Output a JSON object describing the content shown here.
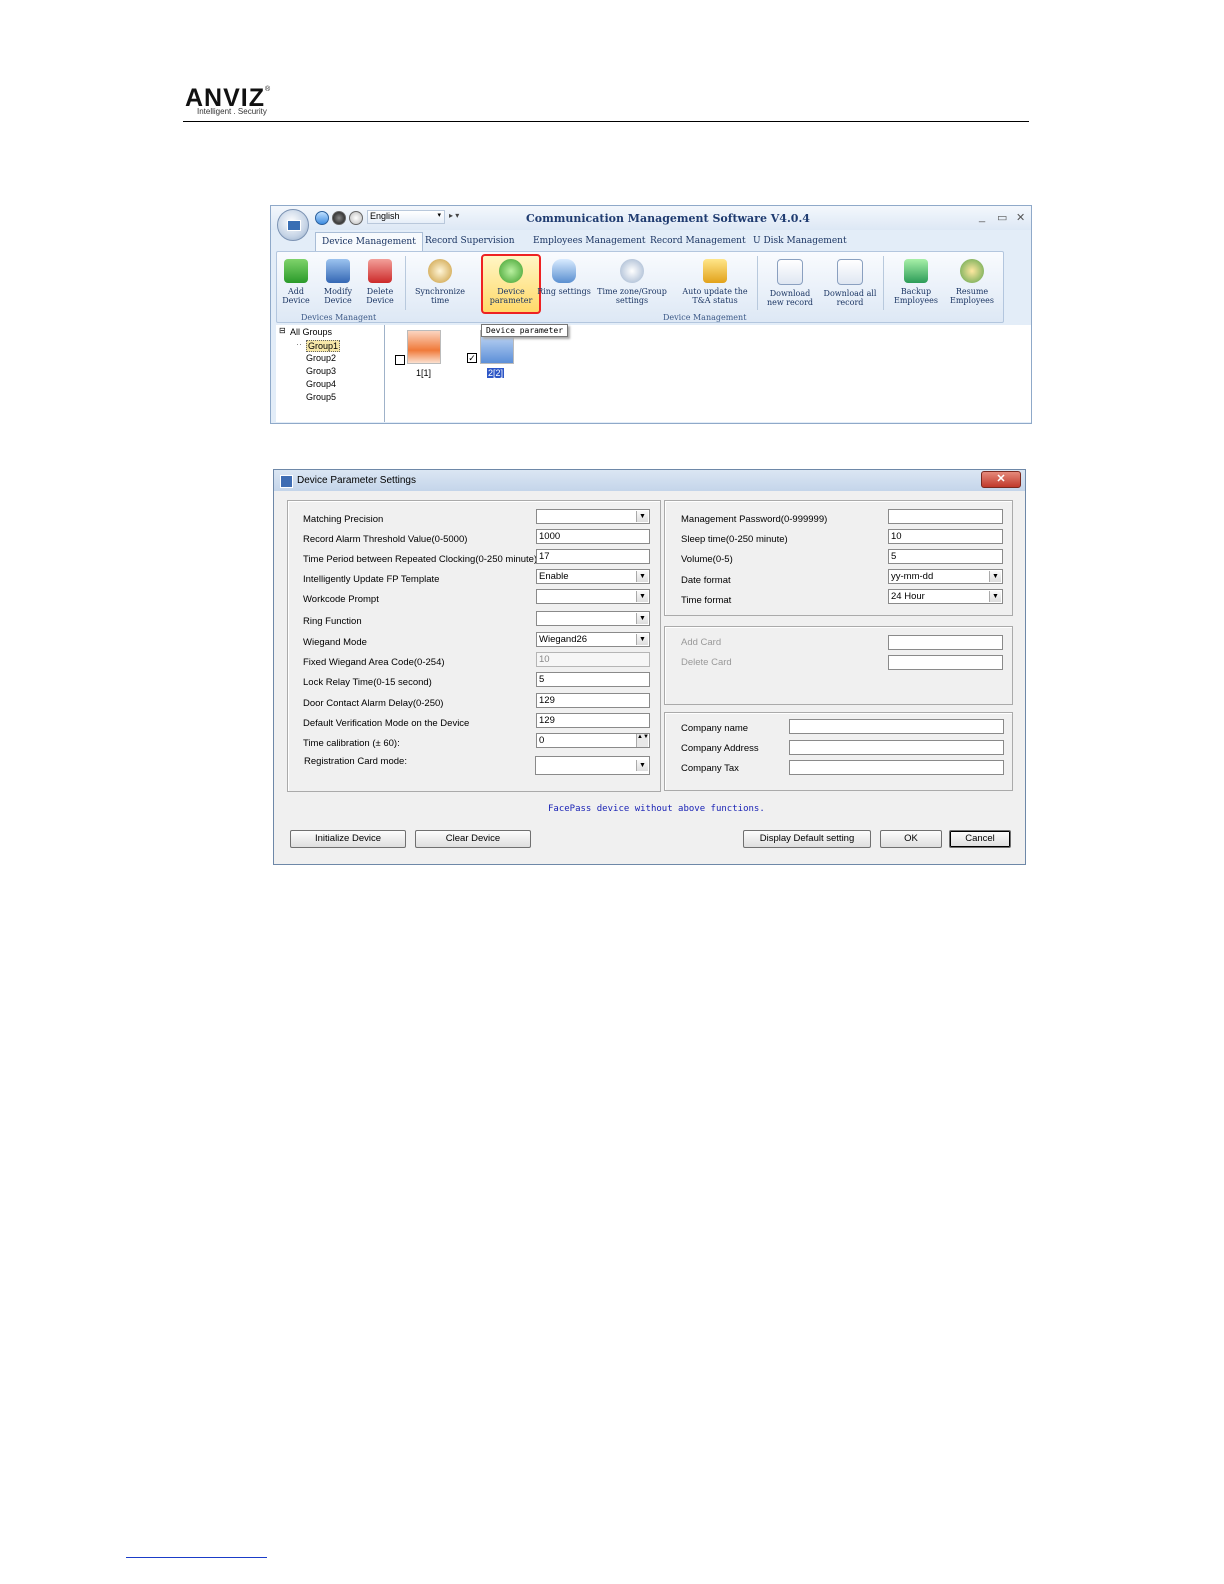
{
  "header": {
    "brand": "ANVIZ",
    "registered": "®",
    "tagline": "Intelligent . Security"
  },
  "app": {
    "language": "English",
    "title": "Communication Management Software V4.0.4",
    "window_buttons": [
      "_",
      "▭",
      "✕"
    ],
    "tabs": [
      "Device Management",
      "Record Supervision",
      "Employees Management",
      "Record Management",
      "U Disk Management"
    ],
    "ribbon": {
      "add_device": "Add Device",
      "modify_device": "Modify Device",
      "delete_device": "Delete Device",
      "group_devices": "Devices Managent",
      "sync_time": "Synchronize time",
      "device_parameter": "Device parameter",
      "ring_settings": "Ring settings",
      "time_zone": "Time zone/Group settings",
      "auto_update": "Auto update the T&A status",
      "group_device_mgmt": "Device Management",
      "download_new": "Download new record",
      "download_all": "Download all record",
      "backup": "Backup Employees",
      "resume": "Resume Employees"
    },
    "tree": {
      "expander": "⊟",
      "root": "All Groups",
      "groups": [
        "Group1",
        "Group2",
        "Group3",
        "Group4",
        "Group5"
      ]
    },
    "devices": [
      {
        "label": "1[1]",
        "checked": false
      },
      {
        "label": "2[2]",
        "checked": true
      }
    ],
    "check_mark": "✓",
    "tooltip": "Device parameter"
  },
  "dialog": {
    "title": "Device Parameter Settings",
    "close": "✕",
    "dropdown_arrow": "▼",
    "spin_arrows": "▲▼",
    "left_fields": [
      {
        "label": "Matching Precision",
        "value": ""
      },
      {
        "label": "Record Alarm Threshold Value(0-5000)",
        "value": "1000"
      },
      {
        "label": "Time Period between Repeated Clocking(0-250 minute)",
        "value": "17"
      },
      {
        "label": "Intelligently Update  FP Template",
        "value": "Enable"
      },
      {
        "label": "Workcode Prompt",
        "value": ""
      },
      {
        "label": "Ring Function",
        "value": ""
      },
      {
        "label": "Wiegand Mode",
        "value": "Wiegand26"
      },
      {
        "label": "Fixed Wiegand Area Code(0-254)",
        "value": "10"
      },
      {
        "label": "Lock Relay Time(0-15 second)",
        "value": "5"
      },
      {
        "label": "Door Contact Alarm Delay(0-250)",
        "value": "129"
      },
      {
        "label": "Default Verification Mode on the Device",
        "value": "129"
      },
      {
        "label": "Time calibration (± 60):",
        "value": "0"
      },
      {
        "label": "Registration Card mode:",
        "value": ""
      }
    ],
    "right_top": [
      {
        "label": "Management Password(0-999999)",
        "value": ""
      },
      {
        "label": "Sleep time(0-250 minute)",
        "value": "10"
      },
      {
        "label": "Volume(0-5)",
        "value": "5"
      },
      {
        "label": "Date format",
        "value": "yy-mm-dd"
      },
      {
        "label": "Time format",
        "value": "24 Hour"
      }
    ],
    "card": {
      "add": "Add Card",
      "delete": "Delete Card"
    },
    "company": {
      "name": "Company name",
      "address": "Company Address",
      "tax": "Company Tax"
    },
    "note": "FacePass device without above functions.",
    "buttons": {
      "initialize": "Initialize Device",
      "clear": "Clear Device",
      "default": "Display Default setting",
      "ok": "OK",
      "cancel": "Cancel"
    }
  }
}
